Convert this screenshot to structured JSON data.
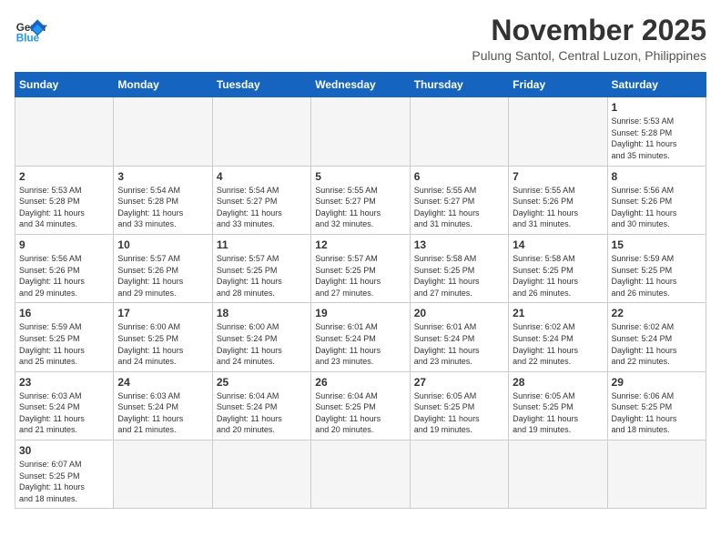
{
  "header": {
    "logo_general": "General",
    "logo_blue": "Blue",
    "month": "November 2025",
    "location": "Pulung Santol, Central Luzon, Philippines"
  },
  "days_of_week": [
    "Sunday",
    "Monday",
    "Tuesday",
    "Wednesday",
    "Thursday",
    "Friday",
    "Saturday"
  ],
  "weeks": [
    [
      {
        "day": "",
        "info": ""
      },
      {
        "day": "",
        "info": ""
      },
      {
        "day": "",
        "info": ""
      },
      {
        "day": "",
        "info": ""
      },
      {
        "day": "",
        "info": ""
      },
      {
        "day": "",
        "info": ""
      },
      {
        "day": "1",
        "info": "Sunrise: 5:53 AM\nSunset: 5:28 PM\nDaylight: 11 hours\nand 35 minutes."
      }
    ],
    [
      {
        "day": "2",
        "info": "Sunrise: 5:53 AM\nSunset: 5:28 PM\nDaylight: 11 hours\nand 34 minutes."
      },
      {
        "day": "3",
        "info": "Sunrise: 5:54 AM\nSunset: 5:28 PM\nDaylight: 11 hours\nand 33 minutes."
      },
      {
        "day": "4",
        "info": "Sunrise: 5:54 AM\nSunset: 5:27 PM\nDaylight: 11 hours\nand 33 minutes."
      },
      {
        "day": "5",
        "info": "Sunrise: 5:55 AM\nSunset: 5:27 PM\nDaylight: 11 hours\nand 32 minutes."
      },
      {
        "day": "6",
        "info": "Sunrise: 5:55 AM\nSunset: 5:27 PM\nDaylight: 11 hours\nand 31 minutes."
      },
      {
        "day": "7",
        "info": "Sunrise: 5:55 AM\nSunset: 5:26 PM\nDaylight: 11 hours\nand 31 minutes."
      },
      {
        "day": "8",
        "info": "Sunrise: 5:56 AM\nSunset: 5:26 PM\nDaylight: 11 hours\nand 30 minutes."
      }
    ],
    [
      {
        "day": "9",
        "info": "Sunrise: 5:56 AM\nSunset: 5:26 PM\nDaylight: 11 hours\nand 29 minutes."
      },
      {
        "day": "10",
        "info": "Sunrise: 5:57 AM\nSunset: 5:26 PM\nDaylight: 11 hours\nand 29 minutes."
      },
      {
        "day": "11",
        "info": "Sunrise: 5:57 AM\nSunset: 5:25 PM\nDaylight: 11 hours\nand 28 minutes."
      },
      {
        "day": "12",
        "info": "Sunrise: 5:57 AM\nSunset: 5:25 PM\nDaylight: 11 hours\nand 27 minutes."
      },
      {
        "day": "13",
        "info": "Sunrise: 5:58 AM\nSunset: 5:25 PM\nDaylight: 11 hours\nand 27 minutes."
      },
      {
        "day": "14",
        "info": "Sunrise: 5:58 AM\nSunset: 5:25 PM\nDaylight: 11 hours\nand 26 minutes."
      },
      {
        "day": "15",
        "info": "Sunrise: 5:59 AM\nSunset: 5:25 PM\nDaylight: 11 hours\nand 26 minutes."
      }
    ],
    [
      {
        "day": "16",
        "info": "Sunrise: 5:59 AM\nSunset: 5:25 PM\nDaylight: 11 hours\nand 25 minutes."
      },
      {
        "day": "17",
        "info": "Sunrise: 6:00 AM\nSunset: 5:25 PM\nDaylight: 11 hours\nand 24 minutes."
      },
      {
        "day": "18",
        "info": "Sunrise: 6:00 AM\nSunset: 5:24 PM\nDaylight: 11 hours\nand 24 minutes."
      },
      {
        "day": "19",
        "info": "Sunrise: 6:01 AM\nSunset: 5:24 PM\nDaylight: 11 hours\nand 23 minutes."
      },
      {
        "day": "20",
        "info": "Sunrise: 6:01 AM\nSunset: 5:24 PM\nDaylight: 11 hours\nand 23 minutes."
      },
      {
        "day": "21",
        "info": "Sunrise: 6:02 AM\nSunset: 5:24 PM\nDaylight: 11 hours\nand 22 minutes."
      },
      {
        "day": "22",
        "info": "Sunrise: 6:02 AM\nSunset: 5:24 PM\nDaylight: 11 hours\nand 22 minutes."
      }
    ],
    [
      {
        "day": "23",
        "info": "Sunrise: 6:03 AM\nSunset: 5:24 PM\nDaylight: 11 hours\nand 21 minutes."
      },
      {
        "day": "24",
        "info": "Sunrise: 6:03 AM\nSunset: 5:24 PM\nDaylight: 11 hours\nand 21 minutes."
      },
      {
        "day": "25",
        "info": "Sunrise: 6:04 AM\nSunset: 5:24 PM\nDaylight: 11 hours\nand 20 minutes."
      },
      {
        "day": "26",
        "info": "Sunrise: 6:04 AM\nSunset: 5:25 PM\nDaylight: 11 hours\nand 20 minutes."
      },
      {
        "day": "27",
        "info": "Sunrise: 6:05 AM\nSunset: 5:25 PM\nDaylight: 11 hours\nand 19 minutes."
      },
      {
        "day": "28",
        "info": "Sunrise: 6:05 AM\nSunset: 5:25 PM\nDaylight: 11 hours\nand 19 minutes."
      },
      {
        "day": "29",
        "info": "Sunrise: 6:06 AM\nSunset: 5:25 PM\nDaylight: 11 hours\nand 18 minutes."
      }
    ],
    [
      {
        "day": "30",
        "info": "Sunrise: 6:07 AM\nSunset: 5:25 PM\nDaylight: 11 hours\nand 18 minutes."
      },
      {
        "day": "",
        "info": ""
      },
      {
        "day": "",
        "info": ""
      },
      {
        "day": "",
        "info": ""
      },
      {
        "day": "",
        "info": ""
      },
      {
        "day": "",
        "info": ""
      },
      {
        "day": "",
        "info": ""
      }
    ]
  ]
}
